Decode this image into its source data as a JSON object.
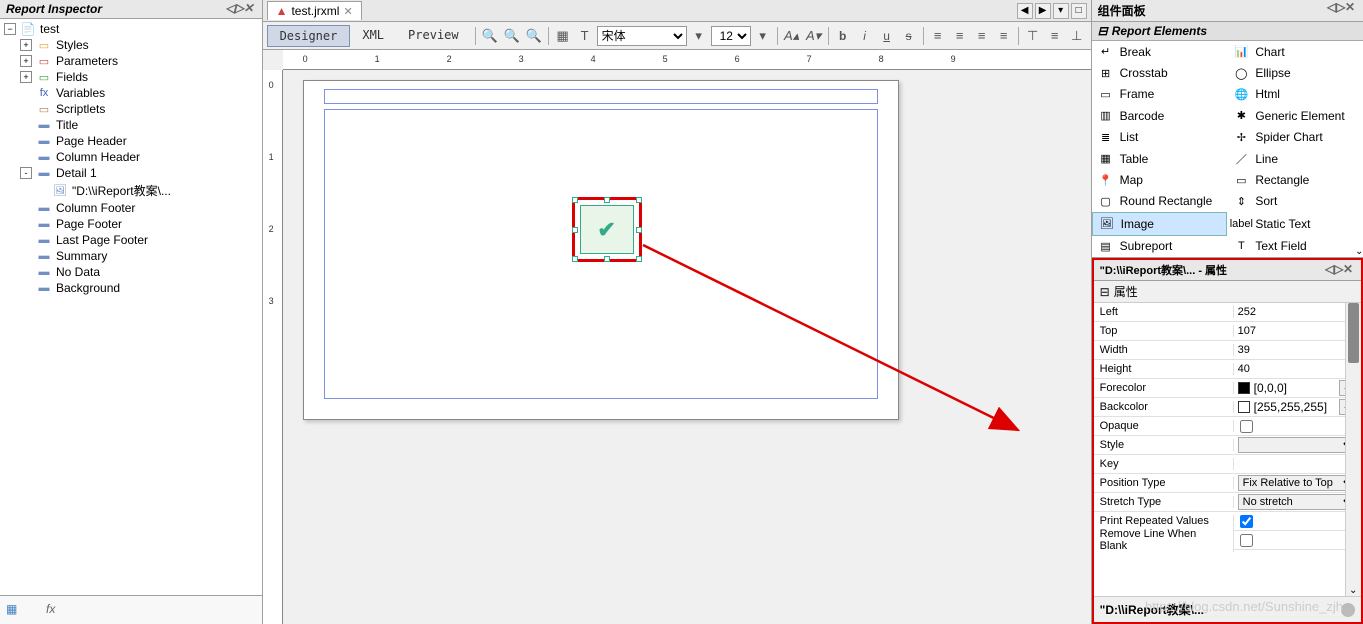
{
  "leftPanel": {
    "title": "Report Inspector",
    "tree": {
      "root": "test",
      "nodes": [
        {
          "label": "Styles",
          "indent": 1,
          "toggle": "+",
          "iconColor": "#e0a030"
        },
        {
          "label": "Parameters",
          "indent": 1,
          "toggle": "+",
          "iconColor": "#d04040"
        },
        {
          "label": "Fields",
          "indent": 1,
          "toggle": "+",
          "iconColor": "#40a040"
        },
        {
          "label": "Variables",
          "indent": 1,
          "toggle": "",
          "iconText": "fx",
          "iconColor": "#4060c0"
        },
        {
          "label": "Scriptlets",
          "indent": 1,
          "toggle": "",
          "iconColor": "#b08050"
        },
        {
          "label": "Title",
          "indent": 1,
          "toggle": "",
          "band": true
        },
        {
          "label": "Page Header",
          "indent": 1,
          "toggle": "",
          "band": true
        },
        {
          "label": "Column Header",
          "indent": 1,
          "toggle": "",
          "band": true
        },
        {
          "label": "Detail 1",
          "indent": 1,
          "toggle": "-",
          "band": true
        },
        {
          "label": "\"D:\\\\iReport教案\\...",
          "indent": 2,
          "toggle": "",
          "image": true
        },
        {
          "label": "Column Footer",
          "indent": 1,
          "toggle": "",
          "band": true
        },
        {
          "label": "Page Footer",
          "indent": 1,
          "toggle": "",
          "band": true
        },
        {
          "label": "Last Page Footer",
          "indent": 1,
          "toggle": "",
          "band": true
        },
        {
          "label": "Summary",
          "indent": 1,
          "toggle": "",
          "band": true
        },
        {
          "label": "No Data",
          "indent": 1,
          "toggle": "",
          "band": true
        },
        {
          "label": "Background",
          "indent": 1,
          "toggle": "",
          "band": true
        }
      ]
    }
  },
  "center": {
    "tabName": "test.jrxml",
    "views": {
      "designer": "Designer",
      "xml": "XML",
      "preview": "Preview"
    },
    "fontName": "宋体",
    "fontSize": "12",
    "rulerH": [
      "0",
      "1",
      "2",
      "3",
      "4",
      "5",
      "6",
      "7",
      "8",
      "9"
    ],
    "rulerV": [
      "0",
      "1",
      "2",
      "3"
    ]
  },
  "palette": {
    "title": "组件面板",
    "section": "Report Elements",
    "items": [
      {
        "label": "Break",
        "icon": "↵",
        "col": 0
      },
      {
        "label": "Chart",
        "icon": "📊",
        "col": 1
      },
      {
        "label": "Crosstab",
        "icon": "⊞",
        "col": 0
      },
      {
        "label": "Ellipse",
        "icon": "◯",
        "col": 1
      },
      {
        "label": "Frame",
        "icon": "▭",
        "col": 0
      },
      {
        "label": "Html",
        "icon": "🌐",
        "col": 1
      },
      {
        "label": "Barcode",
        "icon": "▥",
        "col": 0
      },
      {
        "label": "Generic Element",
        "icon": "✱",
        "col": 1
      },
      {
        "label": "List",
        "icon": "≣",
        "col": 0
      },
      {
        "label": "Spider Chart",
        "icon": "✢",
        "col": 1
      },
      {
        "label": "Table",
        "icon": "▦",
        "col": 0
      },
      {
        "label": "Line",
        "icon": "／",
        "col": 1
      },
      {
        "label": "Map",
        "icon": "📍",
        "col": 0
      },
      {
        "label": "Rectangle",
        "icon": "▭",
        "col": 1
      },
      {
        "label": "Round Rectangle",
        "icon": "▢",
        "col": 0
      },
      {
        "label": "Sort",
        "icon": "⇕",
        "col": 1
      },
      {
        "label": "Image",
        "icon": "🖼",
        "col": 0,
        "selected": true
      },
      {
        "label": "Static Text",
        "icon": "label",
        "col": 1
      },
      {
        "label": "Subreport",
        "icon": "▤",
        "col": 0
      },
      {
        "label": "Text Field",
        "icon": "T",
        "col": 1
      }
    ]
  },
  "properties": {
    "title": "\"D:\\\\iReport教案\\... - 属性",
    "section": "属性",
    "rows": [
      {
        "label": "Left",
        "value": "252",
        "type": "text"
      },
      {
        "label": "Top",
        "value": "107",
        "type": "text"
      },
      {
        "label": "Width",
        "value": "39",
        "type": "text"
      },
      {
        "label": "Height",
        "value": "40",
        "type": "text"
      },
      {
        "label": "Forecolor",
        "value": "[0,0,0]",
        "type": "color",
        "color": "#000"
      },
      {
        "label": "Backcolor",
        "value": "[255,255,255]",
        "type": "color",
        "color": "#fff"
      },
      {
        "label": "Opaque",
        "value": "",
        "type": "checkbox",
        "checked": false
      },
      {
        "label": "Style",
        "value": "",
        "type": "select"
      },
      {
        "label": "Key",
        "value": "",
        "type": "text"
      },
      {
        "label": "Position Type",
        "value": "Fix Relative to Top",
        "type": "select"
      },
      {
        "label": "Stretch Type",
        "value": "No stretch",
        "type": "select"
      },
      {
        "label": "Print Repeated Values",
        "value": "",
        "type": "checkbox",
        "checked": true
      },
      {
        "label": "Remove Line When Blank",
        "value": "",
        "type": "checkbox",
        "checked": false
      }
    ],
    "footer": "\"D:\\\\iReport教案\\..."
  },
  "watermark": "https://blog.csdn.net/Sunshine_zjh"
}
